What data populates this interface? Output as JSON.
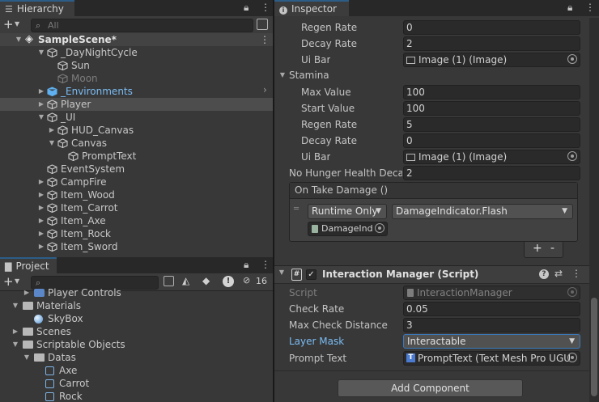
{
  "hierarchy": {
    "tab_label": "Hierarchy",
    "search_placeholder": "All",
    "scene": "SampleScene*",
    "items": [
      {
        "label": "_DayNightCycle",
        "depth": 1,
        "arrow": "down",
        "state": "normal"
      },
      {
        "label": "Sun",
        "depth": 2,
        "arrow": "none",
        "state": "normal"
      },
      {
        "label": "Moon",
        "depth": 2,
        "arrow": "none",
        "state": "disabled"
      },
      {
        "label": "_Environments",
        "depth": 1,
        "arrow": "right",
        "state": "prefab"
      },
      {
        "label": "Player",
        "depth": 1,
        "arrow": "right",
        "state": "selected"
      },
      {
        "label": "_UI",
        "depth": 1,
        "arrow": "down",
        "state": "normal"
      },
      {
        "label": "HUD_Canvas",
        "depth": 2,
        "arrow": "right",
        "state": "normal"
      },
      {
        "label": "Canvas",
        "depth": 2,
        "arrow": "down",
        "state": "normal"
      },
      {
        "label": "PromptText",
        "depth": 3,
        "arrow": "none",
        "state": "normal"
      },
      {
        "label": "EventSystem",
        "depth": 1,
        "arrow": "none",
        "state": "normal"
      },
      {
        "label": "CampFire",
        "depth": 1,
        "arrow": "right",
        "state": "normal"
      },
      {
        "label": "Item_Wood",
        "depth": 1,
        "arrow": "right",
        "state": "normal"
      },
      {
        "label": "Item_Carrot",
        "depth": 1,
        "arrow": "right",
        "state": "normal"
      },
      {
        "label": "Item_Axe",
        "depth": 1,
        "arrow": "right",
        "state": "normal"
      },
      {
        "label": "Item_Rock",
        "depth": 1,
        "arrow": "right",
        "state": "normal"
      },
      {
        "label": "Item_Sword",
        "depth": 1,
        "arrow": "right",
        "state": "normal"
      }
    ]
  },
  "project": {
    "tab_label": "Project",
    "hidden_count": "16",
    "items": [
      {
        "label": "Player Controls",
        "depth": 1,
        "arrow": "right",
        "icon": "input"
      },
      {
        "label": "Materials",
        "depth": 0,
        "arrow": "down",
        "icon": "folder"
      },
      {
        "label": "SkyBox",
        "depth": 1,
        "arrow": "none",
        "icon": "material"
      },
      {
        "label": "Scenes",
        "depth": 0,
        "arrow": "right",
        "icon": "folder"
      },
      {
        "label": "Scriptable Objects",
        "depth": 0,
        "arrow": "down",
        "icon": "folder"
      },
      {
        "label": "Datas",
        "depth": 1,
        "arrow": "down",
        "icon": "folder"
      },
      {
        "label": "Axe",
        "depth": 2,
        "arrow": "none",
        "icon": "asset"
      },
      {
        "label": "Carrot",
        "depth": 2,
        "arrow": "none",
        "icon": "asset"
      },
      {
        "label": "Rock",
        "depth": 2,
        "arrow": "none",
        "icon": "asset"
      }
    ]
  },
  "inspector": {
    "tab_label": "Inspector",
    "regen_rate_label": "Regen Rate",
    "regen_rate_1": "0",
    "decay_rate_label": "Decay Rate",
    "decay_rate_1": "2",
    "ui_bar_label": "Ui Bar",
    "ui_bar_1": "Image (1) (Image)",
    "stamina_label": "Stamina",
    "max_value_label": "Max Value",
    "max_value": "100",
    "start_value_label": "Start Value",
    "start_value": "100",
    "regen_rate_2": "5",
    "decay_rate_2": "0",
    "ui_bar_2": "Image (1) (Image)",
    "no_hunger_label": "No Hunger Health Decay",
    "no_hunger_value": "2",
    "event_label": "On Take Damage ()",
    "event_mode": "Runtime Only",
    "event_function": "DamageIndicator.Flash",
    "event_target": "DamageInd",
    "component_title": "Interaction Manager (Script)",
    "script_label": "Script",
    "script_value": "InteractionManager",
    "check_rate_label": "Check Rate",
    "check_rate": "0.05",
    "max_check_label": "Max Check Distance",
    "max_check": "3",
    "layer_mask_label": "Layer Mask",
    "layer_mask": "Interactable",
    "prompt_text_label": "Prompt Text",
    "prompt_text": "PromptText (Text Mesh Pro UGU",
    "add_component": "Add Component"
  },
  "colors": {
    "panel": "#383838",
    "field": "#2a2a2a",
    "accent": "#2c5d87",
    "prefab_text": "#7bbcf3",
    "disabled_text": "#7d7d7d"
  }
}
